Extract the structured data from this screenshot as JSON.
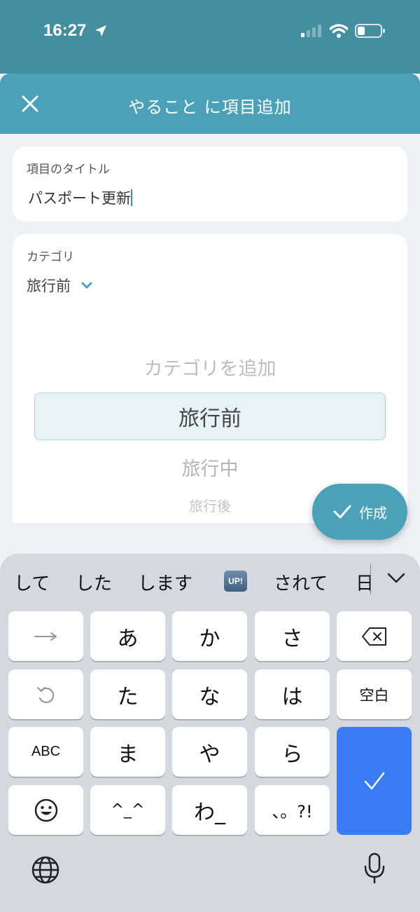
{
  "status": {
    "time": "16:27"
  },
  "header": {
    "title": "やること に項目追加"
  },
  "title_field": {
    "label": "項目のタイトル",
    "value": "パスポート更新"
  },
  "category": {
    "label": "カテゴリ",
    "selected": "旅行前",
    "picker": {
      "above": "カテゴリを追加",
      "selected": "旅行前",
      "below1": "旅行中",
      "below2": "旅行後"
    }
  },
  "fab": {
    "label": "作成"
  },
  "keyboard": {
    "suggestions": [
      "して",
      "した",
      "します",
      "されて",
      "日"
    ],
    "up_badge": "UP!",
    "keys": {
      "a": "あ",
      "ka": "か",
      "sa": "さ",
      "ta": "た",
      "na": "な",
      "ha": "は",
      "space": "空白",
      "abc": "ABC",
      "ma": "ま",
      "ya": "や",
      "ra": "ら",
      "kaomoji": "^_^",
      "wa": "わ_",
      "punct": "、。?!"
    }
  },
  "colors": {
    "accent": "#4ba2b8",
    "status_bg": "#438e9f",
    "enter_key": "#3a7cf3"
  }
}
